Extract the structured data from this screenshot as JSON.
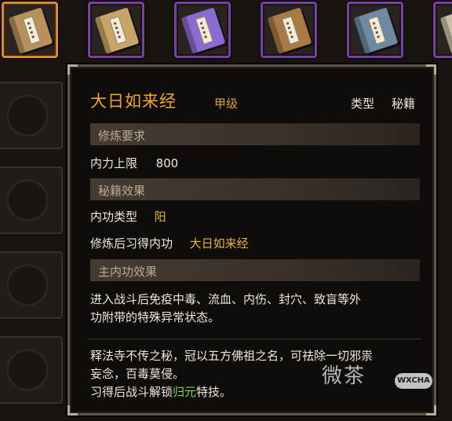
{
  "inventory": {
    "slots": [
      {
        "icon": "scroll-bundle-icon",
        "color": "#b98f5a",
        "selected": true
      },
      {
        "icon": "book-icon",
        "color": "#c8a469",
        "selected": false
      },
      {
        "icon": "book-icon",
        "color": "#8b6ad1",
        "selected": false
      },
      {
        "icon": "book-icon",
        "color": "#a97a45",
        "selected": false
      },
      {
        "icon": "book-icon",
        "color": "#6e8aa0",
        "selected": false
      },
      {
        "icon": "book-icon",
        "color": "#c9c0a7",
        "selected": false
      }
    ]
  },
  "tooltip": {
    "title": "大日如来经",
    "grade": "甲级",
    "type_label": "类型",
    "type_value": "秘籍",
    "requirements": {
      "header": "修炼要求",
      "label": "内力上限",
      "value": "800"
    },
    "effects": {
      "header": "秘籍效果",
      "type_label": "内功类型",
      "type_value": "阳",
      "learn_label": "修炼后习得内功",
      "learn_value": "大日如来经"
    },
    "main_effect": {
      "header": "主内功效果",
      "line1": "进入战斗后免疫中毒、流血、内伤、封穴、致盲等外",
      "line2": "功附带的特殊异常状态。"
    },
    "lore": {
      "line1": "释法寺不传之秘，冠以五方佛祖之名，可祛除一切邪祟",
      "line2": "妄念，百毒莫侵。",
      "line3_prefix": "习得后战斗解锁",
      "line3_highlight": "归元",
      "line3_suffix": "特技。"
    }
  },
  "watermark": {
    "text": "微茶",
    "badge": "WXCHA"
  }
}
